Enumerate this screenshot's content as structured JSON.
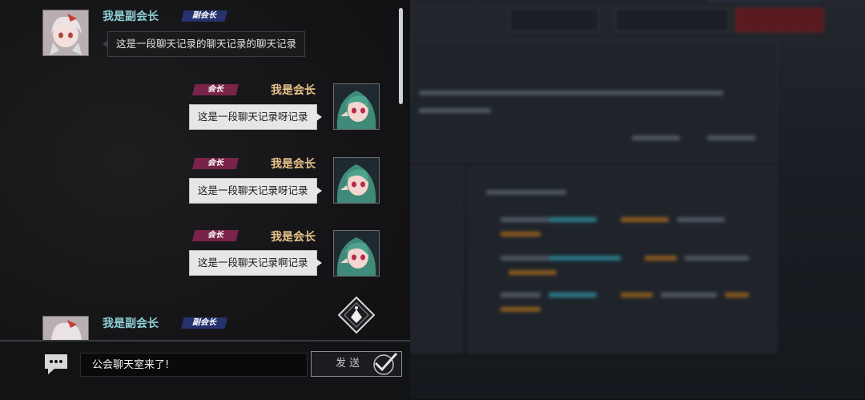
{
  "chat": {
    "messages": [
      {
        "sender": "我是副会长",
        "role_tag": "副会长",
        "text": "这是一段聊天记录的聊天记录的聊天记录",
        "side": "left"
      },
      {
        "sender": "我是会长",
        "role_tag": "会长",
        "text": "这是一段聊天记录呀记录",
        "side": "right"
      },
      {
        "sender": "我是会长",
        "role_tag": "会长",
        "text": "这是一段聊天记录呀记录",
        "side": "right"
      },
      {
        "sender": "我是会长",
        "role_tag": "会长",
        "text": "这是一段聊天记录啊记录",
        "side": "right"
      },
      {
        "sender": "我是副会长",
        "role_tag": "副会长",
        "text": "",
        "side": "left"
      }
    ],
    "input_value": "公会聊天室来了!",
    "send_label": "发送"
  },
  "colors": {
    "vice_name": "#8fd0d6",
    "president_name": "#e8c38a",
    "vice_tag": "#26326e",
    "president_tag": "#7a2348",
    "accent_orange": "#c0392b"
  },
  "icons": {
    "chat": "chat-bubble-icon",
    "send": "checkmark-icon",
    "scroll": "scroll-down-diamond-icon"
  }
}
